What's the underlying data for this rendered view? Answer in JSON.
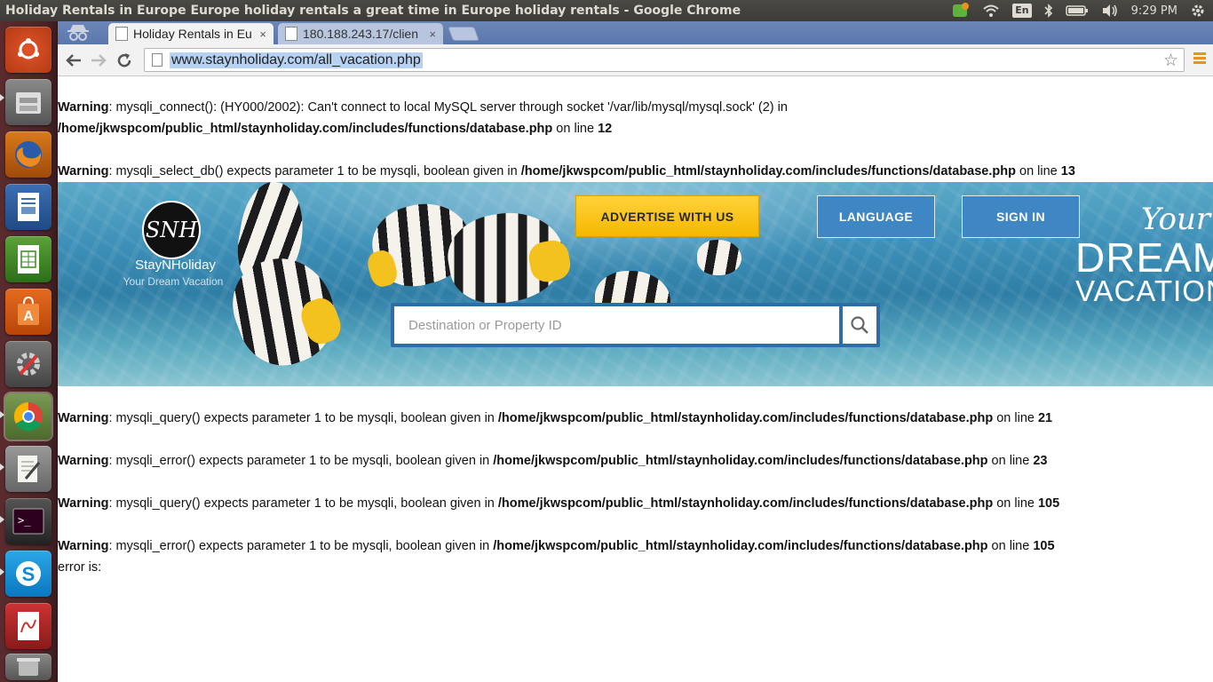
{
  "os": {
    "window_title": "Holiday Rentals in Europe Europe holiday rentals a great time in Europe holiday rentals - Google Chrome",
    "keyboard_layout": "En",
    "clock": "9:29 PM"
  },
  "launcher": {
    "items": [
      "dash-home",
      "files",
      "firefox",
      "writer",
      "calc",
      "software-center",
      "system-settings",
      "chrome",
      "text-editor",
      "terminal",
      "skype",
      "document-viewer",
      "trash"
    ]
  },
  "browser": {
    "tabs": [
      {
        "label": "Holiday Rentals in Eu",
        "close": "×"
      },
      {
        "label": "180.188.243.17/clien",
        "close": "×"
      }
    ],
    "url": "www.staynholiday.com/all_vacation.php"
  },
  "warnings": [
    {
      "label": "Warning",
      "text": ": mysqli_connect(): (HY000/2002): Can't connect to local MySQL server through socket '/var/lib/mysql/mysql.sock' (2) in",
      "path": "/home/jkwspcom/public_html/staynholiday.com/includes/functions/database.php",
      "on_line": " on line ",
      "line": "12"
    },
    {
      "label": "Warning",
      "text": ": mysqli_select_db() expects parameter 1 to be mysqli, boolean given in ",
      "path": "/home/jkwspcom/public_html/staynholiday.com/includes/functions/database.php",
      "on_line": " on line ",
      "line": "13"
    },
    {
      "label": "Warning",
      "text": ": mysqli_query() expects parameter 1 to be mysqli, boolean given in ",
      "path": "/home/jkwspcom/public_html/staynholiday.com/includes/functions/database.php",
      "on_line": " on line ",
      "line": "21"
    },
    {
      "label": "Warning",
      "text": ": mysqli_error() expects parameter 1 to be mysqli, boolean given in ",
      "path": "/home/jkwspcom/public_html/staynholiday.com/includes/functions/database.php",
      "on_line": " on line ",
      "line": "23"
    },
    {
      "label": "Warning",
      "text": ": mysqli_query() expects parameter 1 to be mysqli, boolean given in ",
      "path": "/home/jkwspcom/public_html/staynholiday.com/includes/functions/database.php",
      "on_line": " on line ",
      "line": "105"
    },
    {
      "label": "Warning",
      "text": ": mysqli_error() expects parameter 1 to be mysqli, boolean given in ",
      "path": "/home/jkwspcom/public_html/staynholiday.com/includes/functions/database.php",
      "on_line": " on line ",
      "line": "105"
    }
  ],
  "error_tail": "error is:",
  "site": {
    "logo_monogram": "SNH",
    "logo_name": "StayNHoliday",
    "logo_tagline": "Your Dream Vacation",
    "advertise_label": "ADVERTISE WITH US",
    "language_label": "LANGUAGE",
    "signin_label": "SIGN IN",
    "tagline_your": "Your",
    "tagline_dream": "DREAM",
    "tagline_vacation": "VACATION",
    "search_placeholder": "Destination or Property ID"
  },
  "colors": {
    "accent_yellow": "#f5b800",
    "button_blue": "#3f86c4",
    "launcher_bg": "#4a2326",
    "chrome_frame": "#5b77ad"
  }
}
